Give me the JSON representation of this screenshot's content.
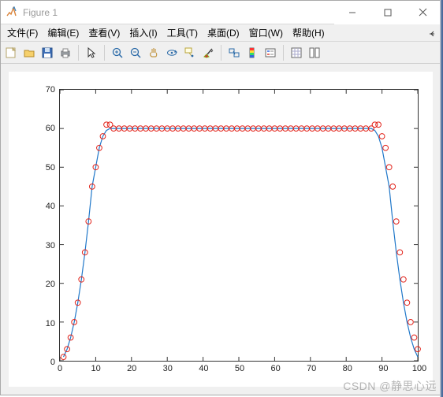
{
  "window": {
    "title": "Figure 1"
  },
  "menus": {
    "file": "文件(F)",
    "edit": "编辑(E)",
    "view": "查看(V)",
    "insert": "插入(I)",
    "tools": "工具(T)",
    "desktop": "桌面(D)",
    "window": "窗口(W)",
    "help": "帮助(H)"
  },
  "toolbar": {
    "icons": [
      "new-figure",
      "open",
      "save",
      "print",
      "arrow",
      "zoom-in",
      "zoom-out",
      "pan",
      "rotate3d",
      "datatip",
      "brush",
      "link",
      "colorbar",
      "legend",
      "axis-props",
      "grid",
      "layout"
    ]
  },
  "axes": {
    "xticks": [
      0,
      10,
      20,
      30,
      40,
      50,
      60,
      70,
      80,
      90,
      100
    ],
    "yticks": [
      0,
      10,
      20,
      30,
      40,
      50,
      60,
      70
    ],
    "xlim": [
      0,
      100
    ],
    "ylim": [
      0,
      70
    ]
  },
  "chart_data": {
    "type": "line",
    "title": "",
    "xlabel": "",
    "ylabel": "",
    "xlim": [
      0,
      100
    ],
    "ylim": [
      0,
      70
    ],
    "series": [
      {
        "name": "line",
        "style": "line",
        "color": "#1f77c9",
        "x": [
          1,
          2,
          3,
          4,
          5,
          6,
          7,
          8,
          9,
          10,
          11,
          12,
          13,
          14,
          15,
          16,
          17,
          18,
          19,
          20,
          21,
          22,
          23,
          24,
          25,
          26,
          27,
          28,
          29,
          30,
          31,
          32,
          33,
          34,
          35,
          36,
          37,
          38,
          39,
          40,
          41,
          42,
          43,
          44,
          45,
          46,
          47,
          48,
          49,
          50,
          51,
          52,
          53,
          54,
          55,
          56,
          57,
          58,
          59,
          60,
          61,
          62,
          63,
          64,
          65,
          66,
          67,
          68,
          69,
          70,
          71,
          72,
          73,
          74,
          75,
          76,
          77,
          78,
          79,
          80,
          81,
          82,
          83,
          84,
          85,
          86,
          87,
          88,
          89,
          90,
          91,
          92,
          93,
          94,
          95,
          96,
          97,
          98,
          99,
          100
        ],
        "y": [
          1,
          3,
          6,
          10,
          15,
          21,
          28,
          36,
          45,
          50,
          55,
          58,
          59.5,
          60,
          60,
          60,
          60,
          60,
          60,
          60,
          60,
          60,
          60,
          60,
          60,
          60,
          60,
          60,
          60,
          60,
          60,
          60,
          60,
          60,
          60,
          60,
          60,
          60,
          60,
          60,
          60,
          60,
          60,
          60,
          60,
          60,
          60,
          60,
          60,
          60,
          60,
          60,
          60,
          60,
          60,
          60,
          60,
          60,
          60,
          60,
          60,
          60,
          60,
          60,
          60,
          60,
          60,
          60,
          60,
          60,
          60,
          60,
          60,
          60,
          60,
          60,
          60,
          60,
          60,
          60,
          60,
          60,
          60,
          60,
          60,
          60,
          60,
          59.5,
          58,
          55,
          50,
          45,
          36,
          28,
          21,
          15,
          10,
          6,
          3,
          1
        ]
      },
      {
        "name": "markers",
        "style": "circle",
        "color": "#e2231a",
        "x": [
          1,
          2,
          3,
          4,
          5,
          6,
          7,
          8,
          9,
          10,
          11,
          12,
          13,
          14,
          15,
          16.5,
          18,
          19.5,
          21,
          22.5,
          24,
          25.5,
          27,
          28.5,
          30,
          31.5,
          33,
          34.5,
          36,
          37.5,
          39,
          40.5,
          42,
          43.5,
          45,
          46.5,
          48,
          49.5,
          51,
          52.5,
          54,
          55.5,
          57,
          58.5,
          60,
          61.5,
          63,
          64.5,
          66,
          67.5,
          69,
          70.5,
          72,
          73.5,
          75,
          76.5,
          78,
          79.5,
          81,
          82.5,
          84,
          85.5,
          87,
          88,
          89,
          90,
          91,
          92,
          93,
          94,
          95,
          96,
          97,
          98,
          99,
          100
        ],
        "y": [
          1,
          3,
          6,
          10,
          15,
          21,
          28,
          36,
          45,
          50,
          55,
          58,
          61,
          61,
          60,
          60,
          60,
          60,
          60,
          60,
          60,
          60,
          60,
          60,
          60,
          60,
          60,
          60,
          60,
          60,
          60,
          60,
          60,
          60,
          60,
          60,
          60,
          60,
          60,
          60,
          60,
          60,
          60,
          60,
          60,
          60,
          60,
          60,
          60,
          60,
          60,
          60,
          60,
          60,
          60,
          60,
          60,
          60,
          60,
          60,
          60,
          60,
          60,
          61,
          61,
          58,
          55,
          50,
          45,
          36,
          28,
          21,
          15,
          10,
          6,
          3,
          1
        ]
      }
    ]
  },
  "watermark": "CSDN @静思心远"
}
